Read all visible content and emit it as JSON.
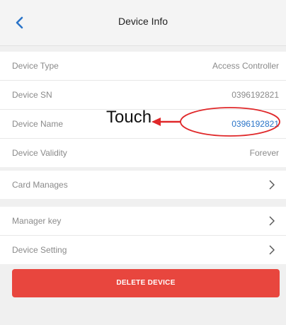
{
  "header": {
    "title": "Device Info",
    "back_icon": "chevron-left-icon",
    "accent_color": "#2a74c8"
  },
  "info": [
    {
      "label": "Device Type",
      "value": "Access Controller"
    },
    {
      "label": "Device SN",
      "value": "0396192821"
    },
    {
      "label": "Device Name",
      "value": "0396192821"
    },
    {
      "label": "Device Validity",
      "value": "Forever"
    }
  ],
  "nav": [
    {
      "label": "Card Manages",
      "icon": "chevron-right-icon"
    },
    {
      "label": "Manager key",
      "icon": "chevron-right-icon"
    },
    {
      "label": "Device Setting",
      "icon": "chevron-right-icon"
    }
  ],
  "annotation": {
    "text": "Touch",
    "color": "#e0282a"
  },
  "delete_button": {
    "label": "DELETE DEVICE",
    "color": "#e8463e"
  }
}
